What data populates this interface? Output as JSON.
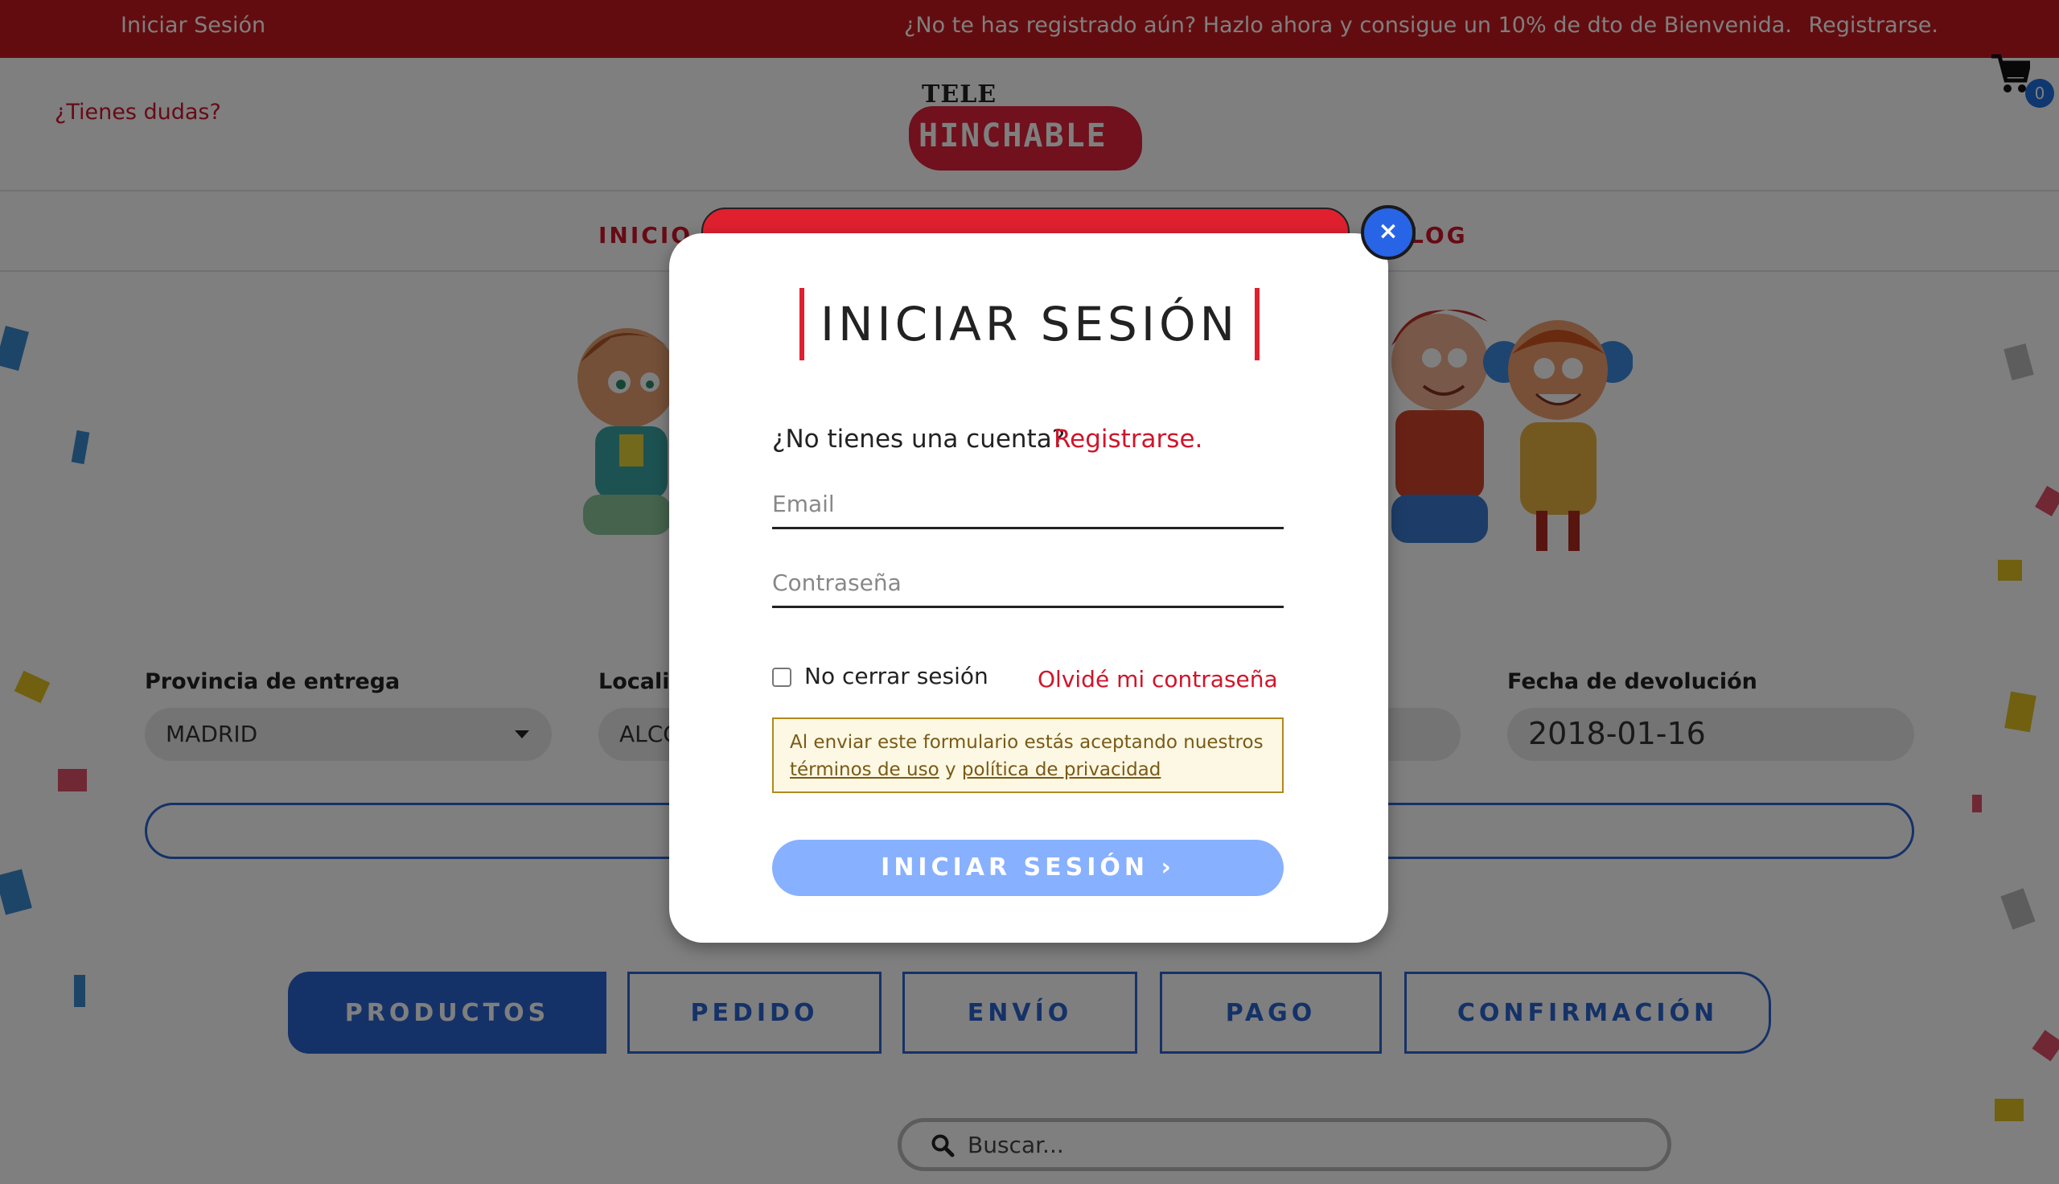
{
  "topbar": {
    "login_link": "Iniciar Sesión",
    "promo_text": "¿No te has registrado aún? Hazlo ahora y consigue un 10% de dto de Bienvenida.",
    "register_link": "Registrarse."
  },
  "header": {
    "help_link": "¿Tienes dudas?",
    "logo_small": "TELE",
    "logo_word": "HINCHABLE",
    "cart_count": "0"
  },
  "nav": {
    "items": [
      "INICIO",
      "LOG"
    ]
  },
  "form": {
    "province_label": "Provincia de entrega",
    "province_value": "MADRID",
    "locality_label": "Localid",
    "locality_value": "ALCO",
    "return_label": "Fecha de devolución",
    "return_value": "2018-01-16"
  },
  "steps": [
    "PRODUCTOS",
    "PEDIDO",
    "ENVÍO",
    "PAGO",
    "CONFIRMACIÓN"
  ],
  "search": {
    "placeholder": "Buscar..."
  },
  "modal": {
    "close": "×",
    "title": "INICIAR SESIÓN",
    "no_account": "¿No tienes una cuenta?",
    "register": "Registrarse.",
    "email_placeholder": "Email",
    "password_placeholder": "Contraseña",
    "remember": "No cerrar sesión",
    "forgot": "Olvidé mi contraseña",
    "notice_prefix": "Al enviar este formulario estás aceptando nuestros",
    "terms": "términos de uso",
    "notice_and": "y",
    "privacy": "política de privacidad",
    "submit": "INICIAR SESIÓN ›"
  },
  "colors": {
    "brand_red": "#c7181f",
    "accent_blue": "#2b64d0",
    "submit_blue": "#87b0ff"
  }
}
